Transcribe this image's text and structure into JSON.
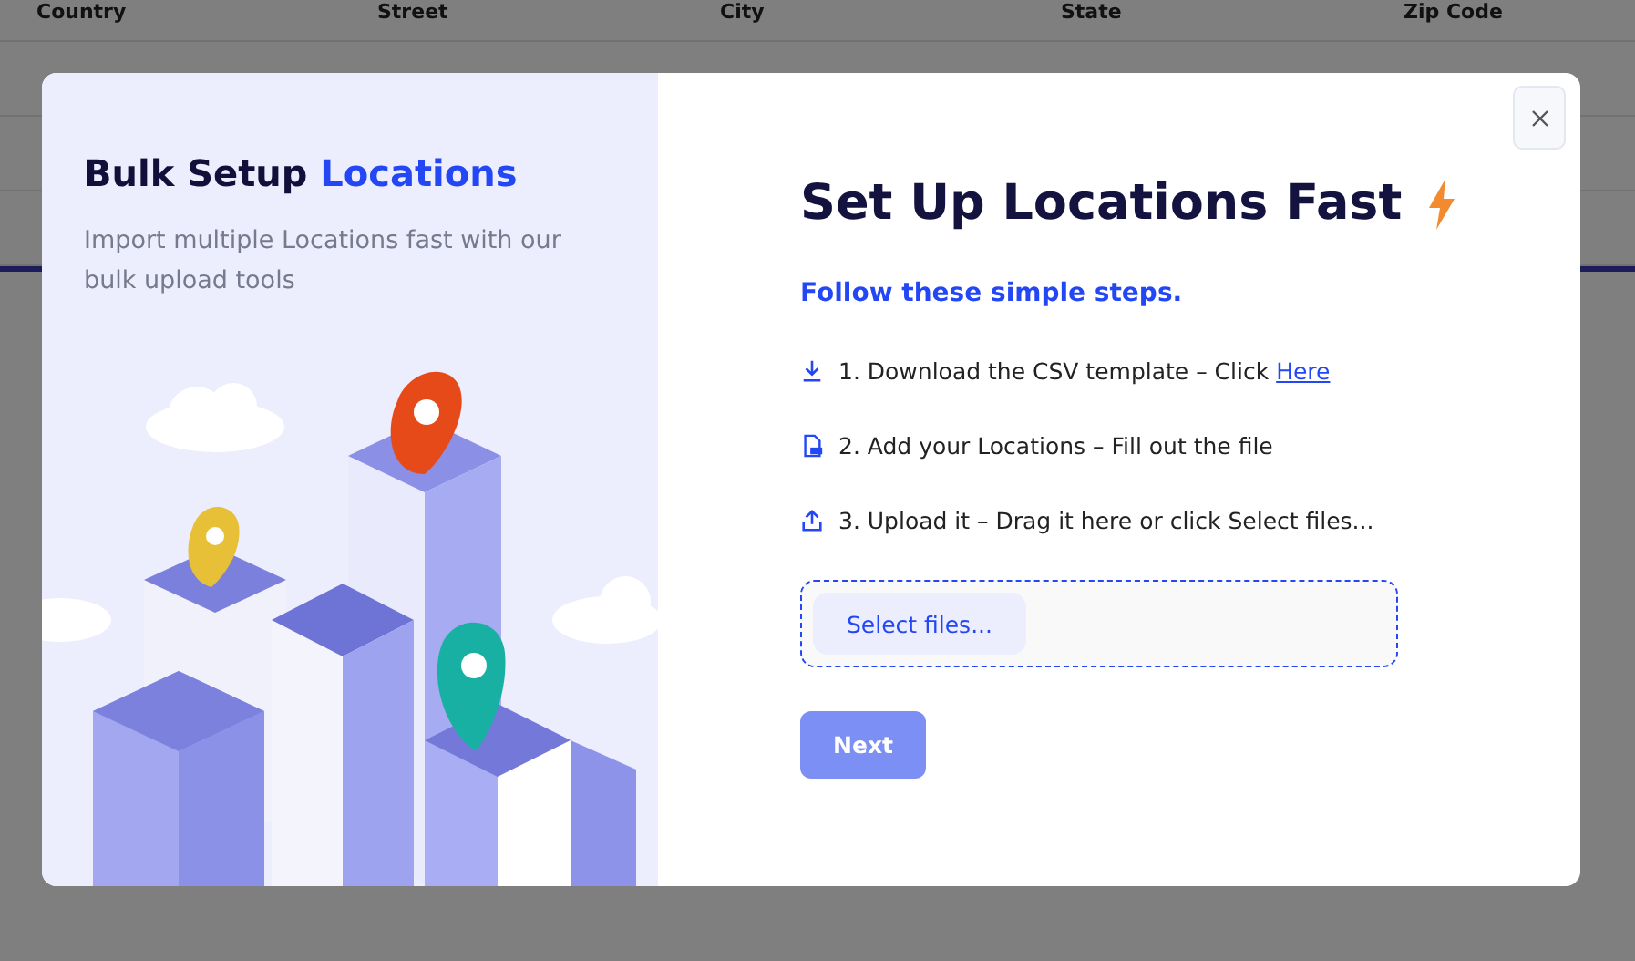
{
  "background_table": {
    "columns": [
      "Country",
      "Street",
      "City",
      "State",
      "Zip Code"
    ]
  },
  "modal": {
    "side_panel": {
      "title": "Bulk Setup",
      "title_highlight": "Locations",
      "description": "Import multiple Locations fast with our bulk upload tools"
    },
    "heading": "Set Up Locations Fast",
    "subheading": "Follow these simple steps.",
    "steps": [
      {
        "kind": "download",
        "text": "1. Download the CSV template – Click ",
        "link": "Here"
      },
      {
        "kind": "file",
        "text": "2. Add your Locations – Fill out the file"
      },
      {
        "kind": "upload",
        "text": "3. Upload it – Drag it here or click Select files..."
      }
    ],
    "dropzone": {
      "button": "Select files..."
    },
    "next_button": {
      "label": "Next",
      "disabled": true
    }
  }
}
